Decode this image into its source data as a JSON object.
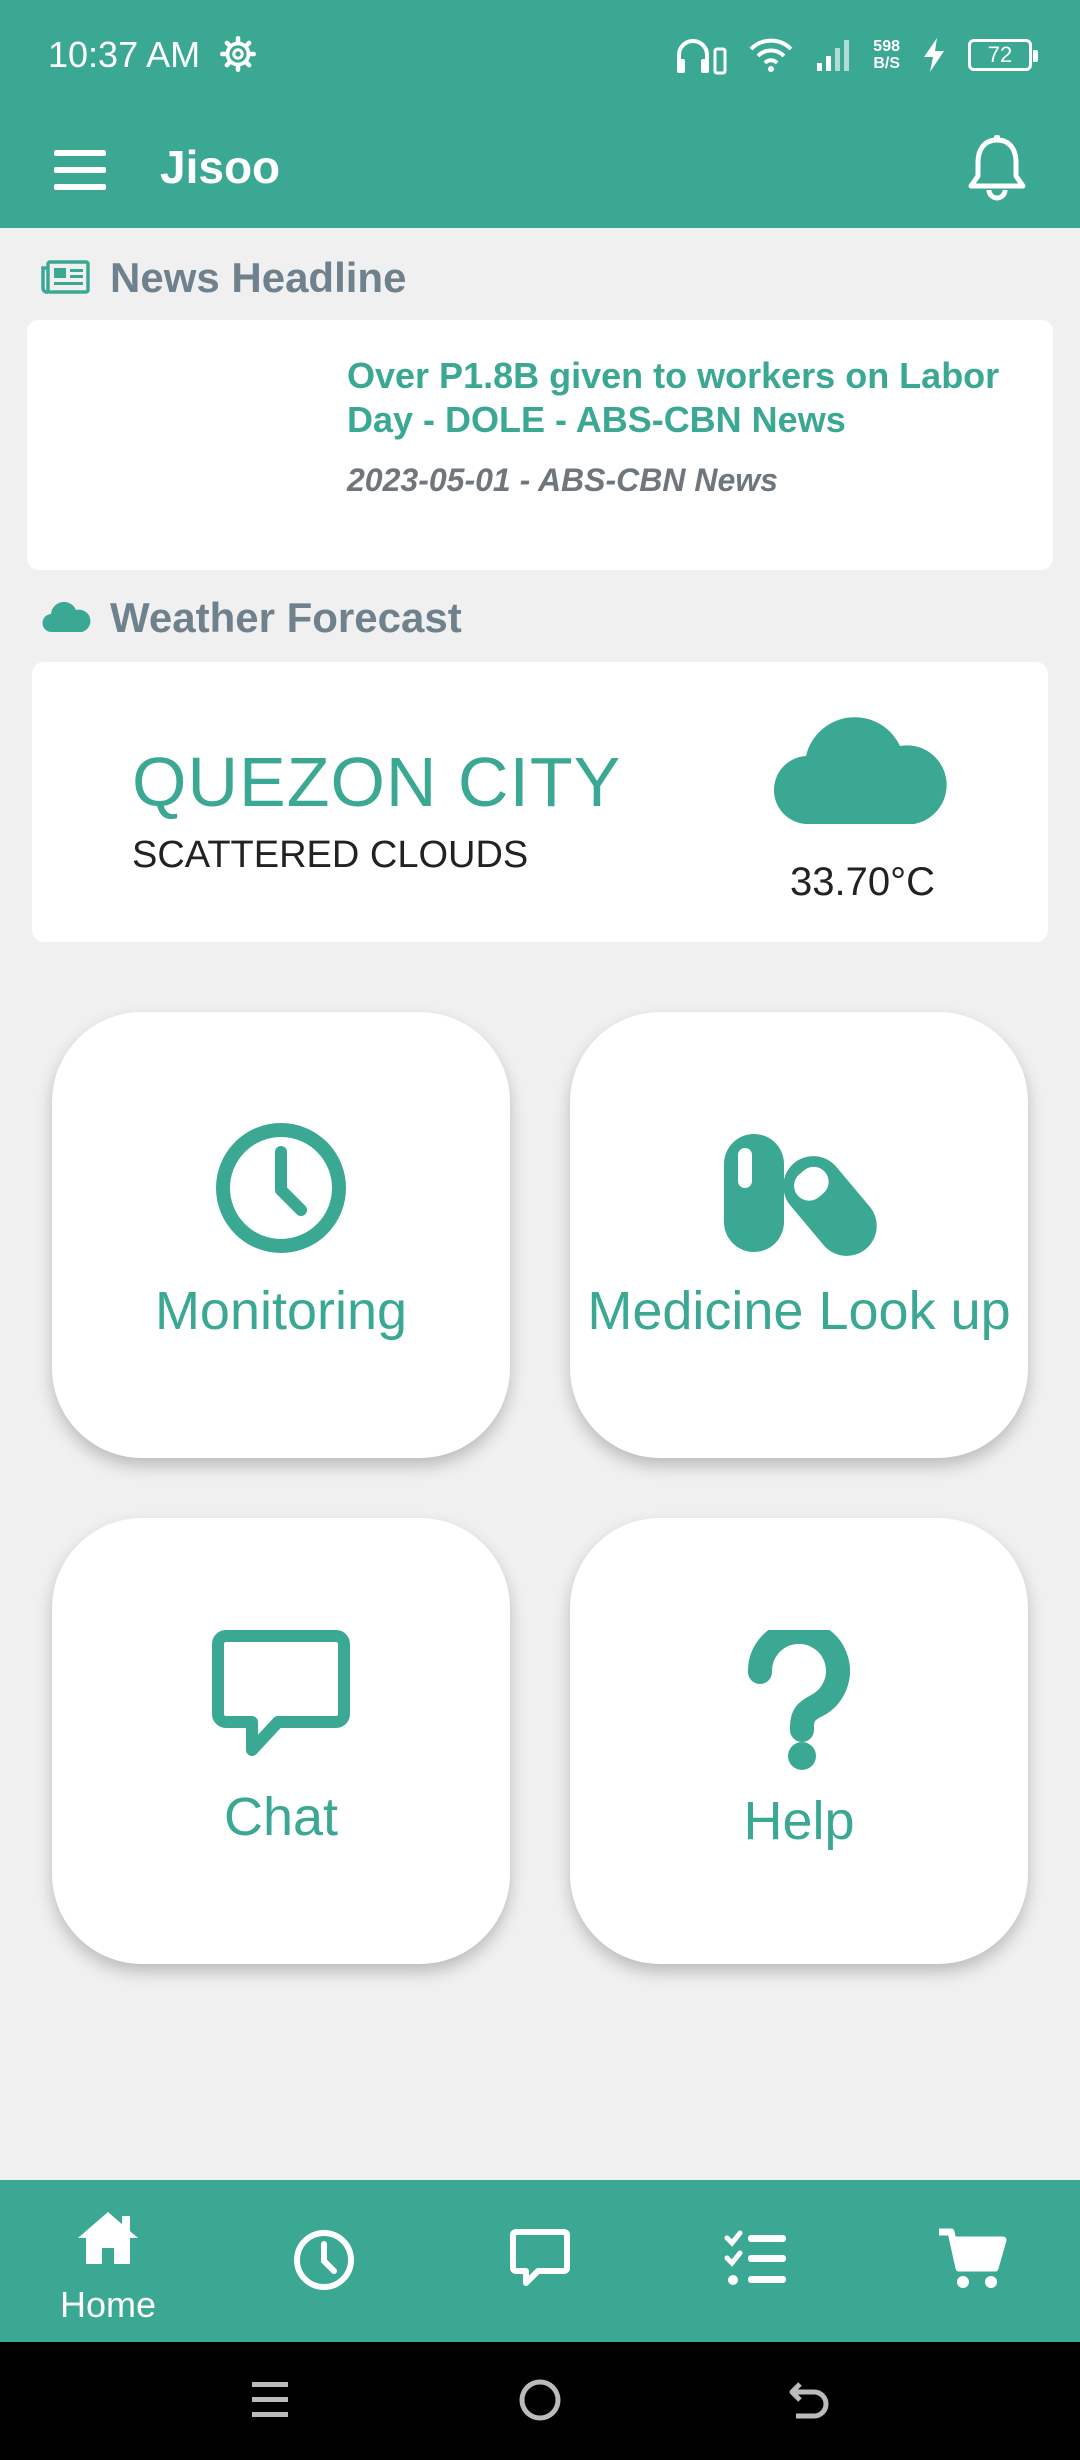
{
  "status_bar": {
    "time": "10:37 AM",
    "net_speed_value": "598",
    "net_speed_unit": "B/S",
    "battery": "72"
  },
  "app_bar": {
    "title": "Jisoo"
  },
  "news": {
    "section_title": "News Headline",
    "headline": "Over P1.8B given to workers on Labor Day - DOLE - ABS-CBN News",
    "meta": "2023-05-01 - ABS-CBN News"
  },
  "weather": {
    "section_title": "Weather Forecast",
    "city": "QUEZON CITY",
    "condition": "SCATTERED CLOUDS",
    "temperature": "33.70°C"
  },
  "tiles": [
    {
      "label": "Monitoring",
      "icon": "clock-icon"
    },
    {
      "label": "Medicine Look up",
      "icon": "pills-icon"
    },
    {
      "label": "Chat",
      "icon": "chat-icon"
    },
    {
      "label": "Help",
      "icon": "question-icon"
    }
  ],
  "bottom_nav": {
    "home_label": "Home",
    "items": [
      "home-icon",
      "clock-icon",
      "chat-icon",
      "checklist-icon",
      "cart-icon"
    ]
  },
  "colors": {
    "primary": "#3aa892",
    "background": "#f0f0f0",
    "section_text": "#6f818c"
  }
}
